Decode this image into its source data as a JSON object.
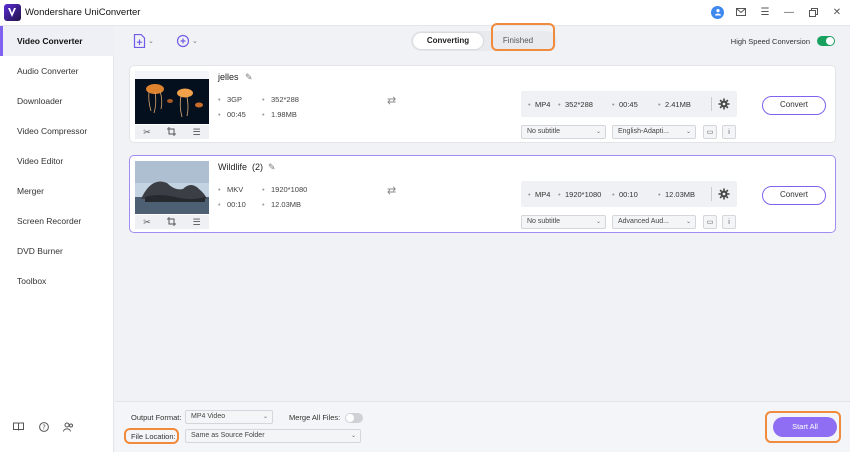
{
  "app": {
    "title": "Wondershare UniConverter"
  },
  "sidebar": {
    "items": [
      {
        "label": "Video Converter",
        "active": true
      },
      {
        "label": "Audio Converter"
      },
      {
        "label": "Downloader"
      },
      {
        "label": "Video Compressor"
      },
      {
        "label": "Video Editor"
      },
      {
        "label": "Merger"
      },
      {
        "label": "Screen Recorder"
      },
      {
        "label": "DVD Burner"
      },
      {
        "label": "Toolbox"
      }
    ]
  },
  "tabs": {
    "converting": "Converting",
    "finished": "Finished"
  },
  "high_speed": {
    "label": "High Speed Conversion",
    "enabled": true
  },
  "files": [
    {
      "name": "jelles",
      "source": {
        "format": "3GP",
        "resolution": "352*288",
        "duration": "00:45",
        "size": "1.98MB"
      },
      "output": {
        "format": "MP4",
        "resolution": "352*288",
        "duration": "00:45",
        "size": "2.41MB"
      },
      "subtitle": "No subtitle",
      "audio": "English-Adapti...",
      "convert_label": "Convert"
    },
    {
      "name": "Wildlife  (2)",
      "source": {
        "format": "MKV",
        "resolution": "1920*1080",
        "duration": "00:10",
        "size": "12.03MB"
      },
      "output": {
        "format": "MP4",
        "resolution": "1920*1080",
        "duration": "00:10",
        "size": "12.03MB"
      },
      "subtitle": "No subtitle",
      "audio": "Advanced Aud...",
      "convert_label": "Convert"
    }
  ],
  "bottom": {
    "output_format_label": "Output Format:",
    "output_format_value": "MP4 Video",
    "merge_label": "Merge All Files:",
    "merge_enabled": false,
    "file_location_label": "File Location:",
    "file_location_value": "Same as Source Folder",
    "start_all": "Start All"
  },
  "colors": {
    "accent": "#7f62ef",
    "highlight": "#f08a3c",
    "toggle_on": "#19a15f"
  }
}
